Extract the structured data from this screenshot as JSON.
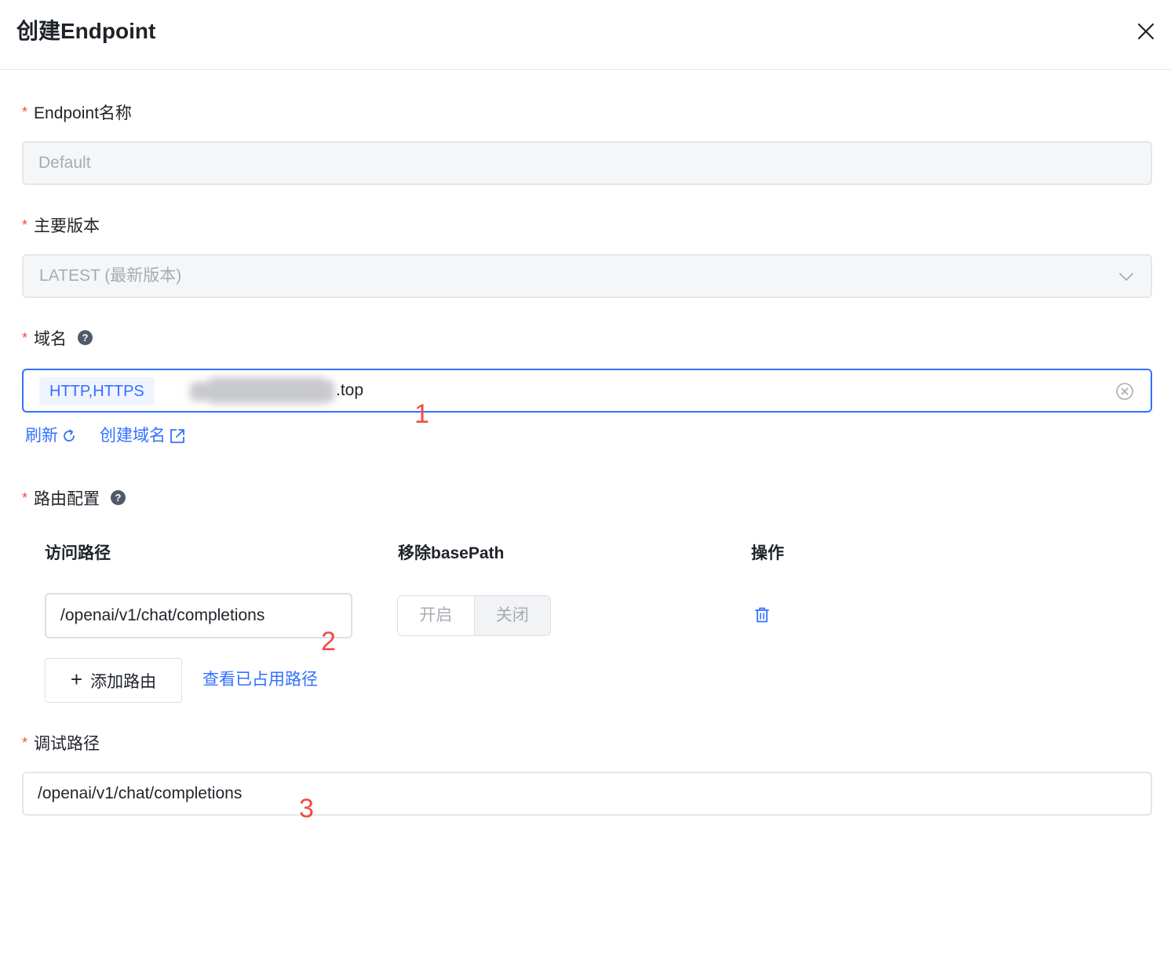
{
  "dialog": {
    "title": "创建Endpoint"
  },
  "form": {
    "required_mark": "*",
    "name": {
      "label": "Endpoint名称",
      "placeholder": "Default"
    },
    "version": {
      "label": "主要版本",
      "value": "LATEST (最新版本)"
    },
    "domain": {
      "label": "域名",
      "help_glyph": "?",
      "protocol_tag": "HTTP,HTTPS",
      "value_visible_suffix": ".top",
      "refresh_label": "刷新",
      "create_label": "创建域名"
    },
    "routes": {
      "label": "路由配置",
      "help_glyph": "?",
      "columns": [
        "访问路径",
        "移除basePath",
        "操作"
      ],
      "rows": [
        {
          "path": "/openai/v1/chat/completions",
          "toggle_options": [
            "开启",
            "关闭"
          ],
          "toggle_selected": "关闭"
        }
      ],
      "add_label": "添加路由",
      "view_used_label": "查看已占用路径"
    },
    "debug_path": {
      "label": "调试路径",
      "value": "/openai/v1/chat/completions"
    }
  },
  "annotations": [
    "1",
    "2",
    "3"
  ],
  "colors": {
    "accent": "#3370ff",
    "required": "#f54a45",
    "annotation": "#f54a45"
  },
  "icons": {
    "close": "close-icon",
    "help": "help-circle-icon",
    "chevron": "chevron-down-icon",
    "clear": "clear-circle-icon",
    "refresh": "refresh-icon",
    "external": "external-link-icon",
    "trash": "trash-icon",
    "plus": "plus-icon"
  }
}
